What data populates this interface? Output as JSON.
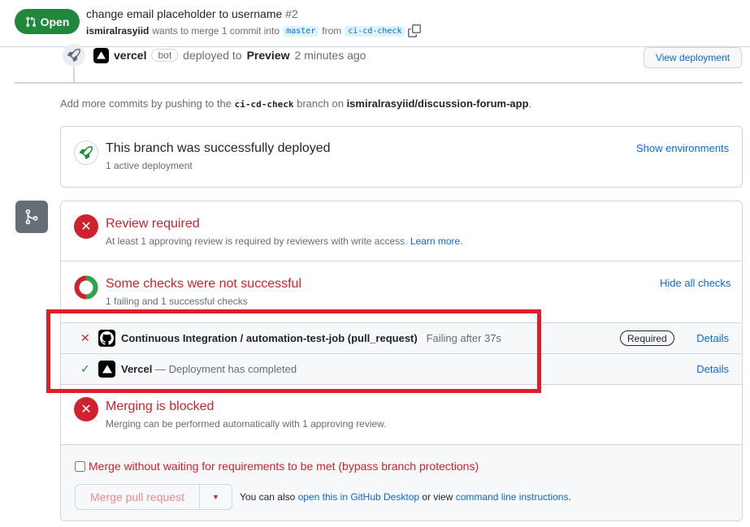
{
  "header": {
    "status": "Open",
    "title": "change email placeholder to username",
    "number": "#2",
    "author": "ismiralrasyiid",
    "merge_text": "wants to merge 1 commit into",
    "base_branch": "master",
    "from_text": "from",
    "head_branch": "ci-cd-check"
  },
  "deployment": {
    "bot_name": "vercel",
    "bot_badge": "bot",
    "deployed_to": "deployed to",
    "environment": "Preview",
    "time": "2 minutes ago",
    "view_button": "View deployment"
  },
  "add_commits": {
    "prefix": "Add more commits by pushing to the",
    "branch": "ci-cd-check",
    "middle": "branch on",
    "repo": "ismiralrasyiid/discussion-forum-app",
    "suffix": "."
  },
  "deployed_box": {
    "title": "This branch was successfully deployed",
    "subtitle": "1 active deployment",
    "link": "Show environments"
  },
  "review": {
    "title": "Review required",
    "subtitle": "At least 1 approving review is required by reviewers with write access.",
    "link": "Learn more."
  },
  "checks": {
    "title": "Some checks were not successful",
    "subtitle": "1 failing and 1 successful checks",
    "link": "Hide all checks",
    "items": [
      {
        "name": "Continuous Integration / automation-test-job (pull_request)",
        "status": "Failing after 37s",
        "badge": "Required",
        "details": "Details",
        "state": "fail"
      },
      {
        "name": "Vercel",
        "status": "— Deployment has completed",
        "details": "Details",
        "state": "success"
      }
    ]
  },
  "blocked": {
    "title": "Merging is blocked",
    "subtitle": "Merging can be performed automatically with 1 approving review."
  },
  "merge": {
    "bypass_label": "Merge without waiting for requirements to be met (bypass branch protections)",
    "button": "Merge pull request",
    "note_prefix": "You can also",
    "link_desktop": "open this in GitHub Desktop",
    "note_middle": "or view",
    "link_cli": "command line instructions",
    "note_suffix": "."
  },
  "colors": {
    "open_green": "#1f883d",
    "danger_red": "#cf222e",
    "link_blue": "#0969da",
    "highlight_red": "#e11d2a"
  }
}
